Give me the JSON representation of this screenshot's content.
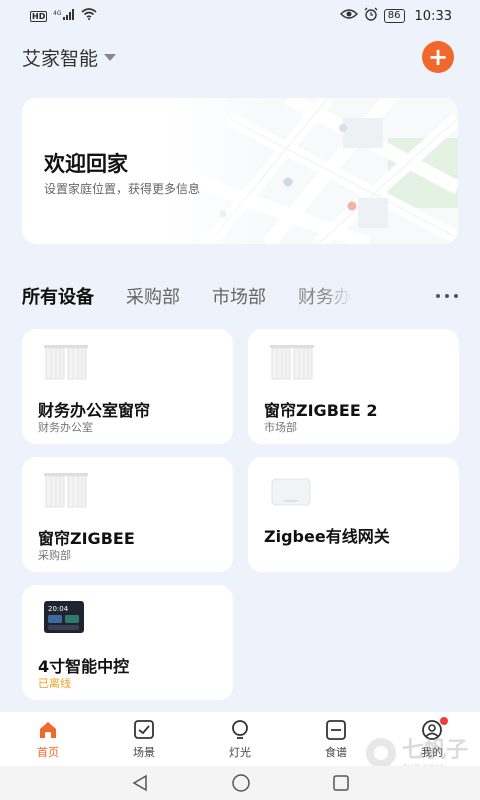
{
  "status_bar": {
    "left_badge": "HD",
    "signal": "⁴ᴳ",
    "battery": "86",
    "time": "10:33"
  },
  "header": {
    "home_name": "艾家智能",
    "add_icon": "plus-icon"
  },
  "welcome": {
    "title": "欢迎回家",
    "subtitle": "设置家庭位置，获得更多信息"
  },
  "tabs": [
    {
      "label": "所有设备",
      "active": true
    },
    {
      "label": "采购部",
      "active": false
    },
    {
      "label": "市场部",
      "active": false
    },
    {
      "label": "财务办",
      "active": false
    }
  ],
  "devices": [
    {
      "name": "财务办公室窗帘",
      "room": "财务办公室",
      "icon": "curtain-icon"
    },
    {
      "name": "窗帘ZIGBEE 2",
      "room": "市场部",
      "icon": "curtain-icon"
    },
    {
      "name": "窗帘ZIGBEE",
      "room": "采购部",
      "icon": "curtain-icon"
    },
    {
      "name": "Zigbee有线网关",
      "room": "",
      "icon": "gateway-icon"
    },
    {
      "name": "4寸智能中控",
      "room": "已离线",
      "icon": "control-panel-icon",
      "panel_time": "20:04",
      "offline": true
    }
  ],
  "bottom_nav": [
    {
      "label": "首页",
      "icon": "home-icon",
      "active": true
    },
    {
      "label": "场景",
      "icon": "scene-icon",
      "active": false
    },
    {
      "label": "灯光",
      "icon": "bulb-icon",
      "active": false
    },
    {
      "label": "食谱",
      "icon": "recipe-icon",
      "active": false
    },
    {
      "label": "我的",
      "icon": "profile-icon",
      "active": false
    }
  ],
  "watermark": {
    "text": "七帆子",
    "sub": "7YZ.COM"
  },
  "colors": {
    "accent": "#f2682a",
    "background": "#eef3fb",
    "offline": "#f0a020"
  }
}
